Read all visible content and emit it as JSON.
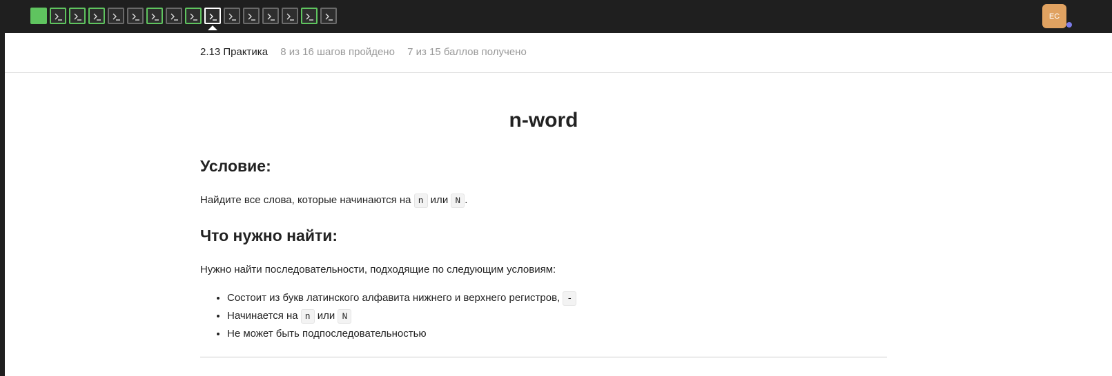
{
  "topbar": {
    "steps": [
      {
        "type": "theory",
        "state": "passed"
      },
      {
        "type": "code",
        "state": "passed"
      },
      {
        "type": "code",
        "state": "passed"
      },
      {
        "type": "code",
        "state": "passed"
      },
      {
        "type": "code",
        "state": "todo"
      },
      {
        "type": "code",
        "state": "todo"
      },
      {
        "type": "code",
        "state": "passed"
      },
      {
        "type": "code",
        "state": "todo"
      },
      {
        "type": "code",
        "state": "passed"
      },
      {
        "type": "code",
        "state": "current"
      },
      {
        "type": "code",
        "state": "todo"
      },
      {
        "type": "code",
        "state": "todo"
      },
      {
        "type": "code",
        "state": "todo"
      },
      {
        "type": "code",
        "state": "todo"
      },
      {
        "type": "code",
        "state": "passed"
      },
      {
        "type": "code",
        "state": "todo"
      }
    ],
    "avatar_initials": "EC",
    "accent_green": "#5fc45f",
    "avatar_color": "#e0a261"
  },
  "subheader": {
    "lesson_title": "2.13 Практика",
    "progress": "8 из 16 шагов пройдено",
    "score": "7 из 15 баллов  получено"
  },
  "main": {
    "title": "n-word",
    "condition_heading": "Условие:",
    "condition_text_before": "Найдите все слова, которые начинаются на ",
    "condition_code_1": "n",
    "condition_text_mid": " или ",
    "condition_code_2": "N",
    "condition_text_after": ".",
    "find_heading": "Что нужно найти:",
    "find_intro": "Нужно найти последовательности, подходящие по следующим условиям:",
    "rule_1_text": "Состоит из букв латинского алфавита нижнего и верхнего регистров, ",
    "rule_1_code": "-",
    "rule_2_text_before": "Начинается на ",
    "rule_2_code_1": "n",
    "rule_2_text_mid": " или ",
    "rule_2_code_2": "N",
    "rule_3_text": "Не может быть подпоследовательностью"
  }
}
